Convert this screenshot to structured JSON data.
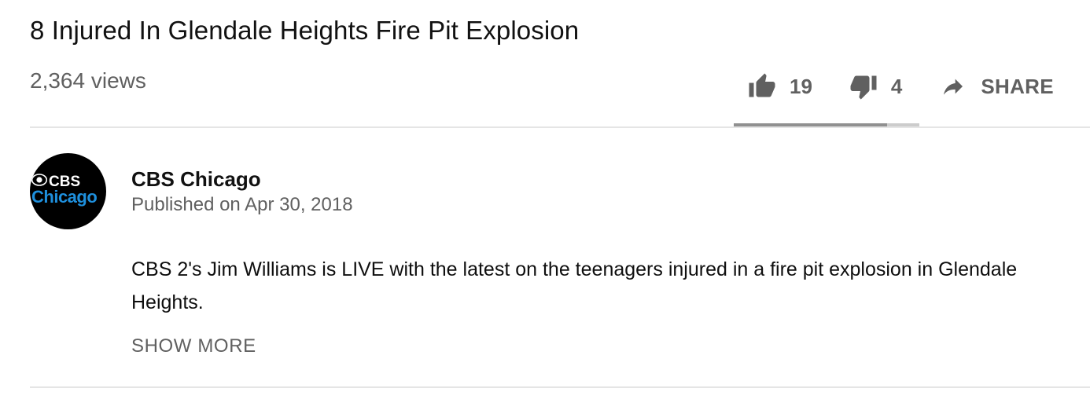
{
  "video": {
    "title": "8 Injured In Glendale Heights Fire Pit Explosion",
    "views": "2,364 views"
  },
  "actions": {
    "like_count": "19",
    "dislike_count": "4",
    "share_label": "SHARE",
    "like_ratio": 0.826
  },
  "channel": {
    "name": "CBS Chicago",
    "published": "Published on Apr 30, 2018",
    "avatar_text_top": "CBS",
    "avatar_text_bottom": "Chicago"
  },
  "description": {
    "text": "CBS 2's Jim Williams is LIVE with the latest on the teenagers injured in a fire pit explosion in Glendale Heights.",
    "show_more_label": "SHOW MORE"
  },
  "icons": {
    "like": "thumbs-up-icon",
    "dislike": "thumbs-down-icon",
    "share": "share-arrow-icon",
    "cbs_eye": "cbs-eye-icon"
  },
  "colors": {
    "text_primary": "#111111",
    "text_secondary": "#606060",
    "divider": "#e5e5e5",
    "sentiment_fill": "#909090",
    "sentiment_track": "#cccccc",
    "avatar_bg": "#000000",
    "avatar_accent": "#1e8fdc"
  }
}
